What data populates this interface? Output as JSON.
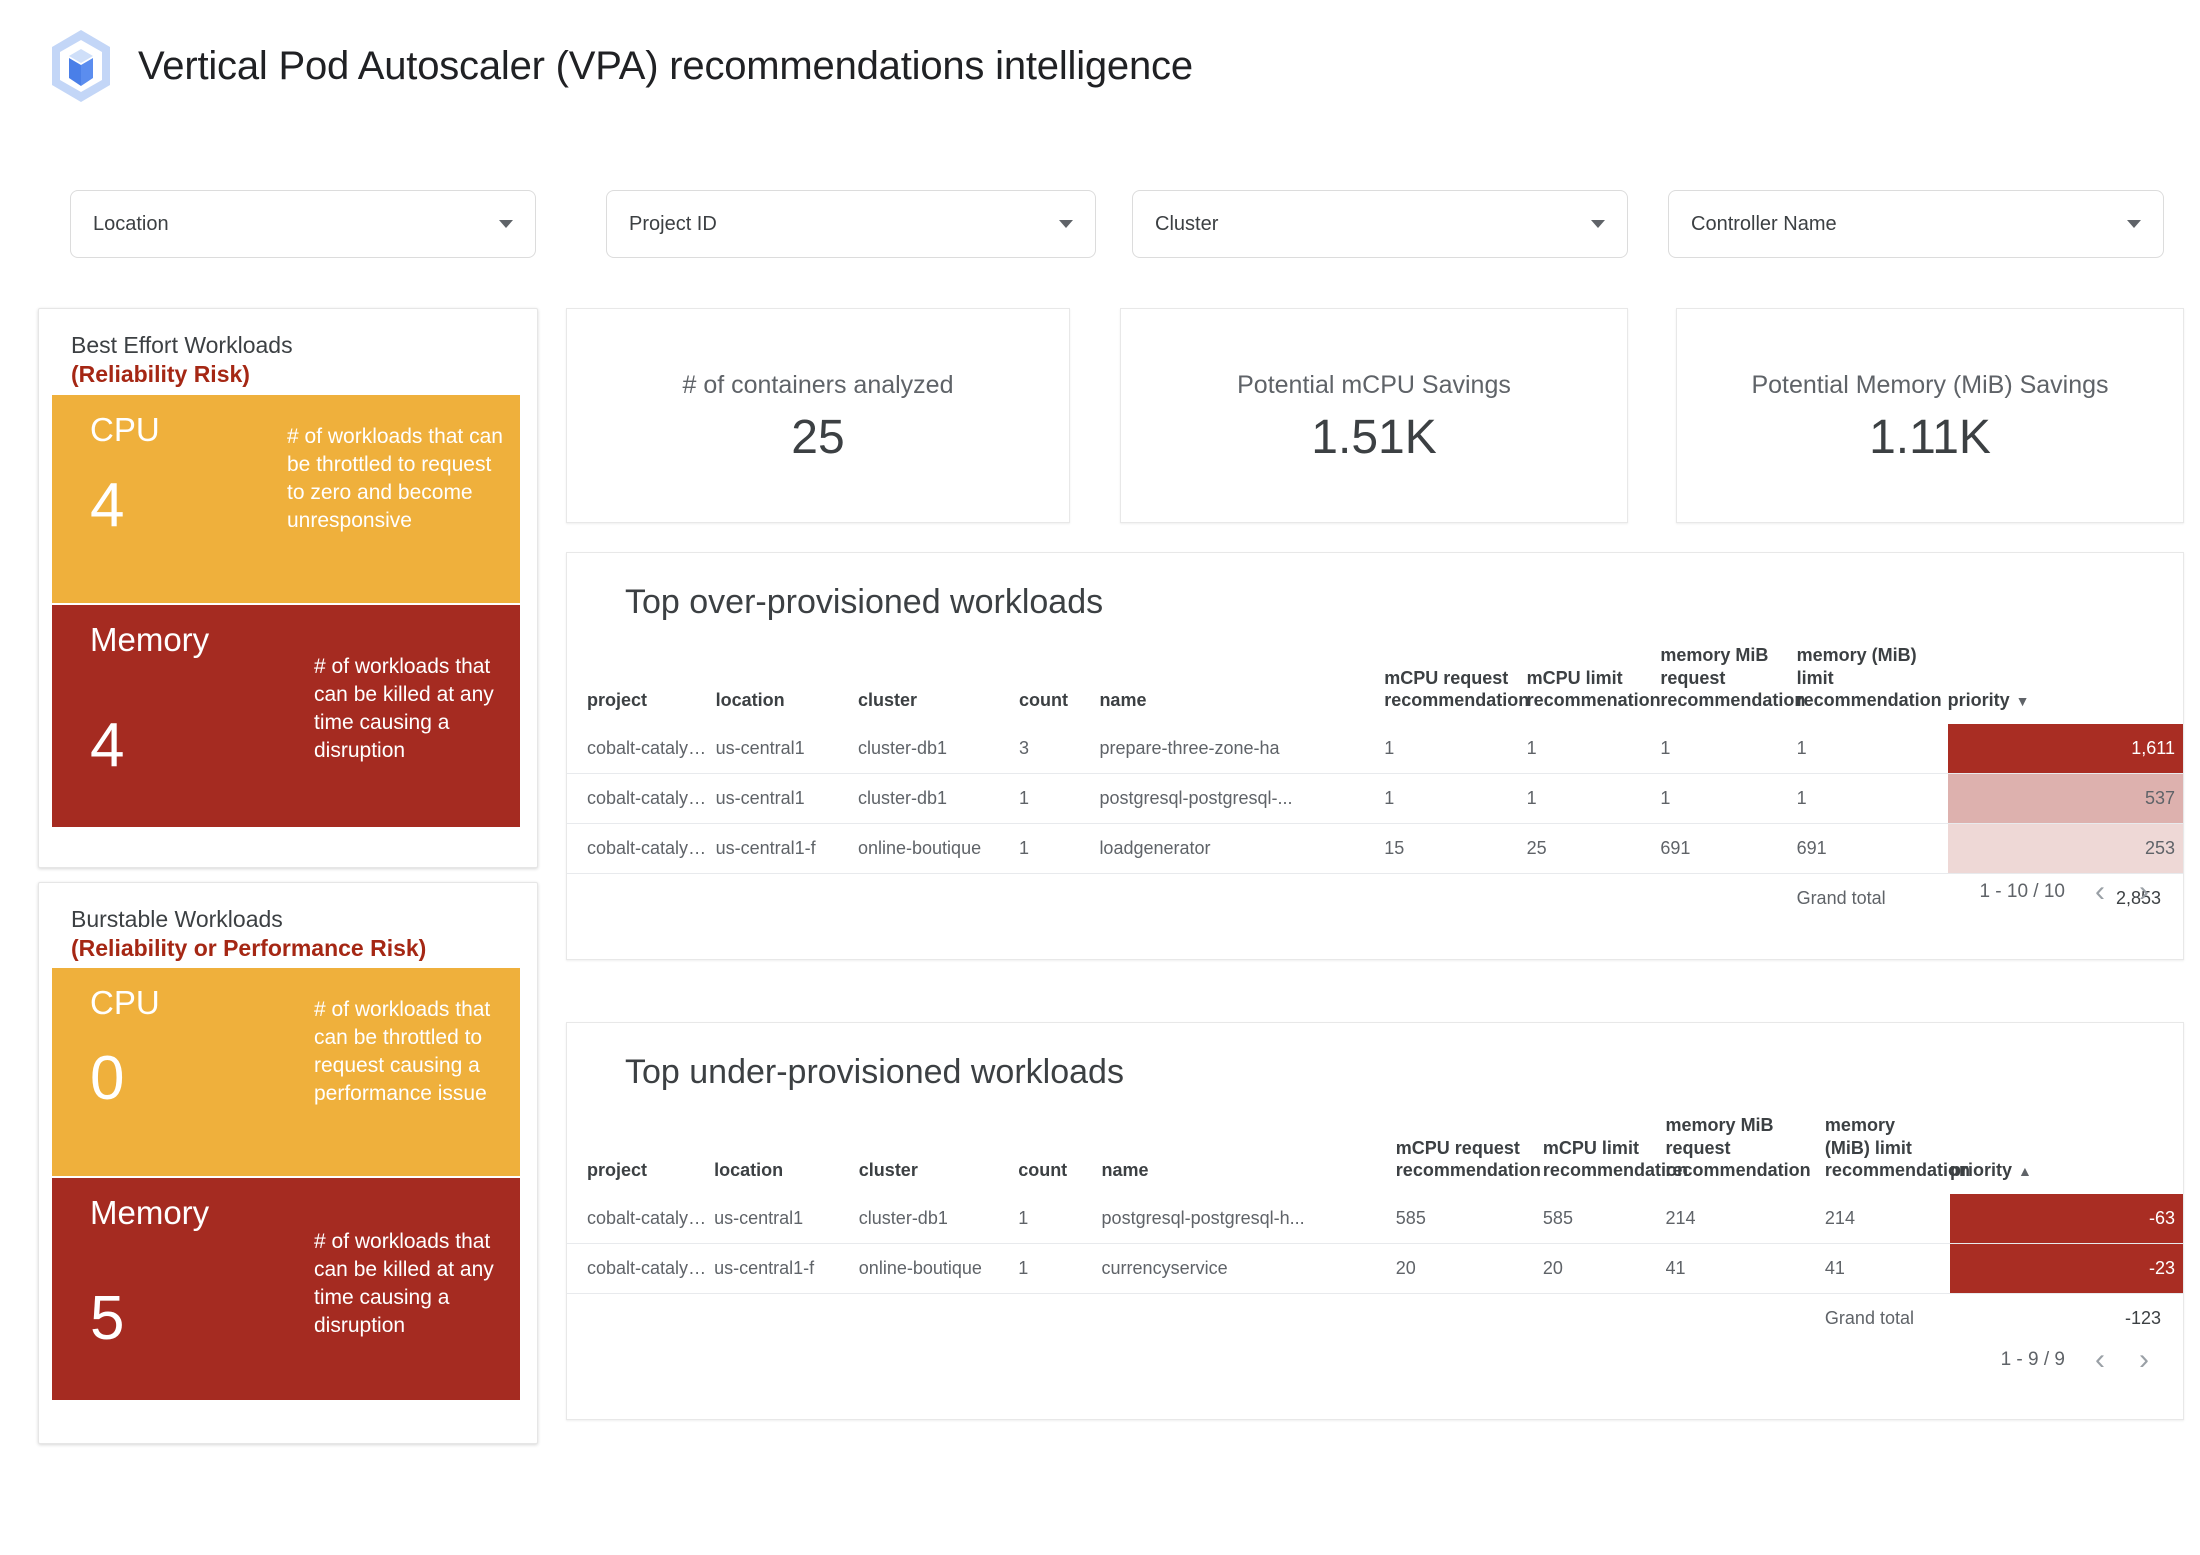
{
  "header": {
    "title": "Vertical Pod Autoscaler (VPA) recommendations intelligence",
    "logo_icon": "gke-hexagon-cube-icon"
  },
  "filters": [
    {
      "label": "Location",
      "icon": "chevron-down-icon"
    },
    {
      "label": "Project ID",
      "icon": "chevron-down-icon"
    },
    {
      "label": "Cluster",
      "icon": "chevron-down-icon"
    },
    {
      "label": "Controller Name",
      "icon": "chevron-down-icon"
    }
  ],
  "risk_cards": [
    {
      "title": "Best Effort Workloads",
      "subtitle": "(Reliability Risk)",
      "cpu": {
        "metric": "CPU",
        "value": "4",
        "description": "# of workloads that can be throttled to request to zero and become unresponsive"
      },
      "memory": {
        "metric": "Memory",
        "value": "4",
        "description": "# of workloads that can be killed at any time causing a disruption"
      }
    },
    {
      "title": "Burstable Workloads",
      "subtitle": "(Reliability or Performance Risk)",
      "cpu": {
        "metric": "CPU",
        "value": "0",
        "description": "# of workloads that can be throttled to request causing a performance issue"
      },
      "memory": {
        "metric": "Memory",
        "value": "5",
        "description": "# of workloads that can be killed at any time causing a disruption"
      }
    }
  ],
  "kpis": [
    {
      "label": "# of containers analyzed",
      "value": "25"
    },
    {
      "label": "Potential mCPU Savings",
      "value": "1.51K"
    },
    {
      "label": "Potential Memory (MiB) Savings",
      "value": "1.11K"
    }
  ],
  "tables": {
    "over": {
      "title": "Top over-provisioned workloads",
      "columns": [
        "project",
        "location",
        "cluster",
        "count",
        "name",
        "mCPU request recommendation",
        "mCPU limit recommenation",
        "memory MiB request recommendation",
        "memory (MiB) limit recommendation",
        "priority"
      ],
      "sort": {
        "column": "priority",
        "direction": "desc",
        "glyph": "▼"
      },
      "rows": [
        {
          "project": "cobalt-catalyst...",
          "location": "us-central1",
          "cluster": "cluster-db1",
          "count": "3",
          "name": "prepare-three-zone-ha",
          "mcpu_request": "1",
          "mcpu_limit": "1",
          "mem_request": "1",
          "mem_limit": "1",
          "priority": "1,611",
          "priority_color": "#a92d23",
          "priority_text_color": "#ffffff"
        },
        {
          "project": "cobalt-catalyst...",
          "location": "us-central1",
          "cluster": "cluster-db1",
          "count": "1",
          "name": "postgresql-postgresql-...",
          "mcpu_request": "1",
          "mcpu_limit": "1",
          "mem_request": "1",
          "mem_limit": "1",
          "priority": "537",
          "priority_color": "#ddb1ae",
          "priority_text_color": "#5f6368"
        },
        {
          "project": "cobalt-catalyst...",
          "location": "us-central1-f",
          "cluster": "online-boutique",
          "count": "1",
          "name": "loadgenerator",
          "mcpu_request": "15",
          "mcpu_limit": "25",
          "mem_request": "691",
          "mem_limit": "691",
          "priority": "253",
          "priority_color": "#eed8d6",
          "priority_text_color": "#5f6368"
        }
      ],
      "grand_total_label": "Grand total",
      "grand_total_value": "2,853",
      "pagination": {
        "range": "1 - 10 / 10",
        "prev": "‹",
        "next": "›"
      }
    },
    "under": {
      "title": "Top under-provisioned workloads",
      "columns": [
        "project",
        "location",
        "cluster",
        "count",
        "name",
        "mCPU request recommendation",
        "mCPU limit recommendation",
        "memory MiB request recommendation",
        "memory (MiB) limit recommendation",
        "priority"
      ],
      "sort": {
        "column": "priority",
        "direction": "asc",
        "glyph": "▲"
      },
      "rows": [
        {
          "project": "cobalt-catalyst-...",
          "location": "us-central1",
          "cluster": "cluster-db1",
          "count": "1",
          "name": "postgresql-postgresql-h...",
          "mcpu_request": "585",
          "mcpu_limit": "585",
          "mem_request": "214",
          "mem_limit": "214",
          "priority": "-63",
          "priority_color": "#a92d23",
          "priority_text_color": "#ffffff"
        },
        {
          "project": "cobalt-catalyst-...",
          "location": "us-central1-f",
          "cluster": "online-boutique",
          "count": "1",
          "name": "currencyservice",
          "mcpu_request": "20",
          "mcpu_limit": "20",
          "mem_request": "41",
          "mem_limit": "41",
          "priority": "-23",
          "priority_color": "#a92d23",
          "priority_text_color": "#ffffff"
        }
      ],
      "grand_total_label": "Grand total",
      "grand_total_value": "-123",
      "pagination": {
        "range": "1 - 9 / 9",
        "prev": "‹",
        "next": "›"
      }
    }
  },
  "colors": {
    "amber": "#efb03c",
    "red": "#a52b21",
    "risk_text": "#a52714",
    "heat_high": "#a92d23",
    "heat_mid": "#ddb1ae",
    "heat_low": "#eed8d6",
    "logo_light": "#c3d6f7",
    "logo_blue": "#5b8def"
  }
}
